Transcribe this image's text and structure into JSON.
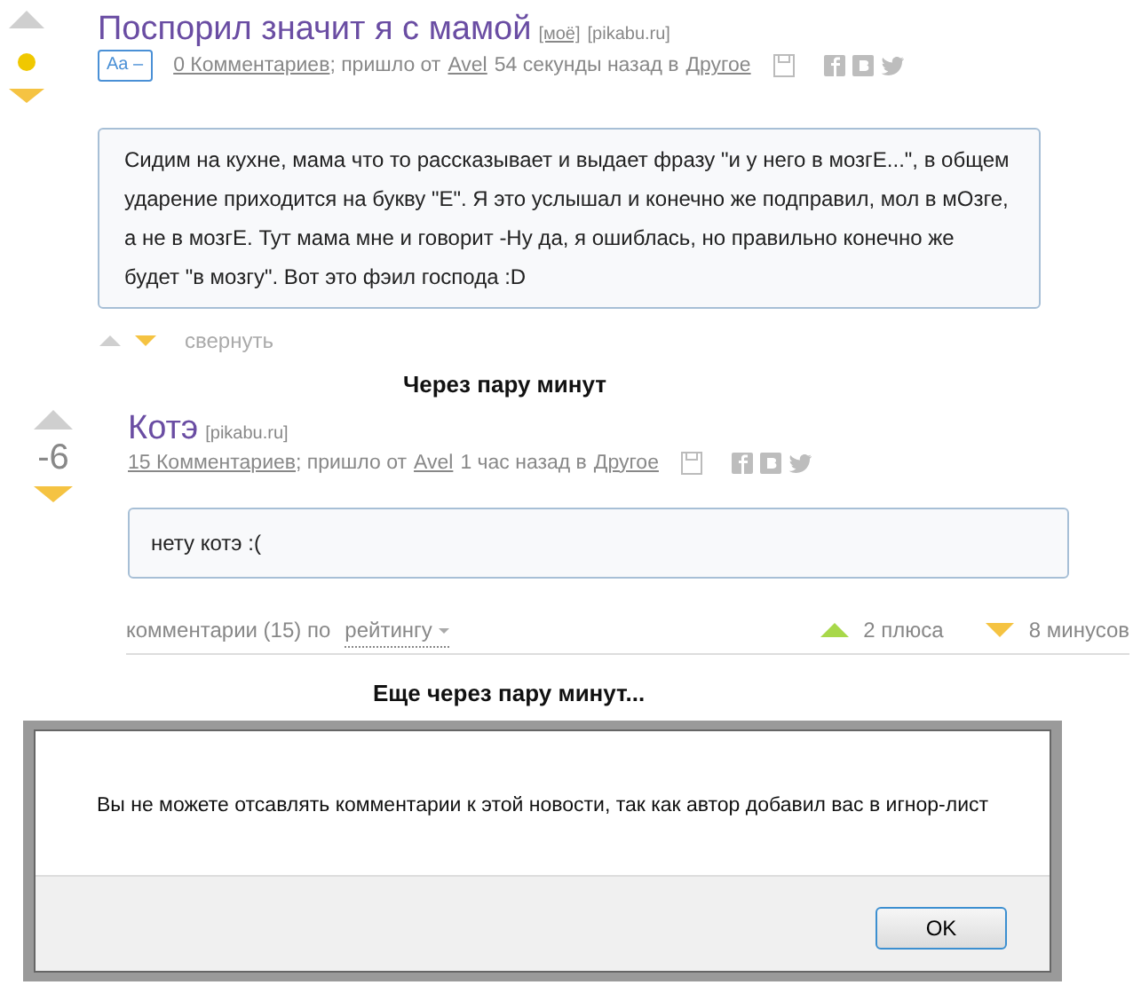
{
  "posts": [
    {
      "title": "Поспорил значит я с мамой",
      "tags": [
        {
          "text": "[моё]",
          "link": true
        },
        {
          "text": "[pikabu.ru]",
          "link": false
        }
      ],
      "font_toggle": "Aa –",
      "comments": "0 Комментариев",
      "via": "; пришло от",
      "author": "Avel",
      "time": "54 секунды назад в",
      "category": "Другое",
      "body": "Сидим на кухне, мама что то рассказывает и выдает фразу \"и у него в мозгЕ...\", в общем ударение приходится на букву \"Е\". Я это услышал и конечно же подправил, мол в мОзге, а не в мозгЕ. Тут мама мне и говорит -Ну да, я ошиблась, но правильно конечно же будет \"в мозгу\". Вот это фэил господа :D",
      "vote": {
        "upvoted": false,
        "downvoted": true
      },
      "footer": {
        "kind": "collapse",
        "upvoted": false,
        "downvoted": true,
        "label": "свернуть"
      }
    },
    {
      "title": "Котэ",
      "tags": [
        {
          "text": "[pikabu.ru]",
          "link": false
        }
      ],
      "comments": "15 Комментариев",
      "via": "; пришло от",
      "author": "Avel",
      "time": "1 час назад в",
      "category": "Другое",
      "body": "нету котэ :(",
      "vote": {
        "score": "-6",
        "upvoted": false,
        "downvoted": true
      },
      "footer": {
        "kind": "comments",
        "label": "комментарии (15) по",
        "sort": "рейтингу",
        "pluses": "2 плюса",
        "minuses": "8 минусов"
      }
    }
  ],
  "captions": [
    "Через пару минут",
    "Еще через пару минут..."
  ],
  "dialog": {
    "message": "Вы не можете отсавлять комментарии к этой новости, так как автор добавил вас в игнор-лист",
    "buttons": [
      "OK"
    ]
  }
}
